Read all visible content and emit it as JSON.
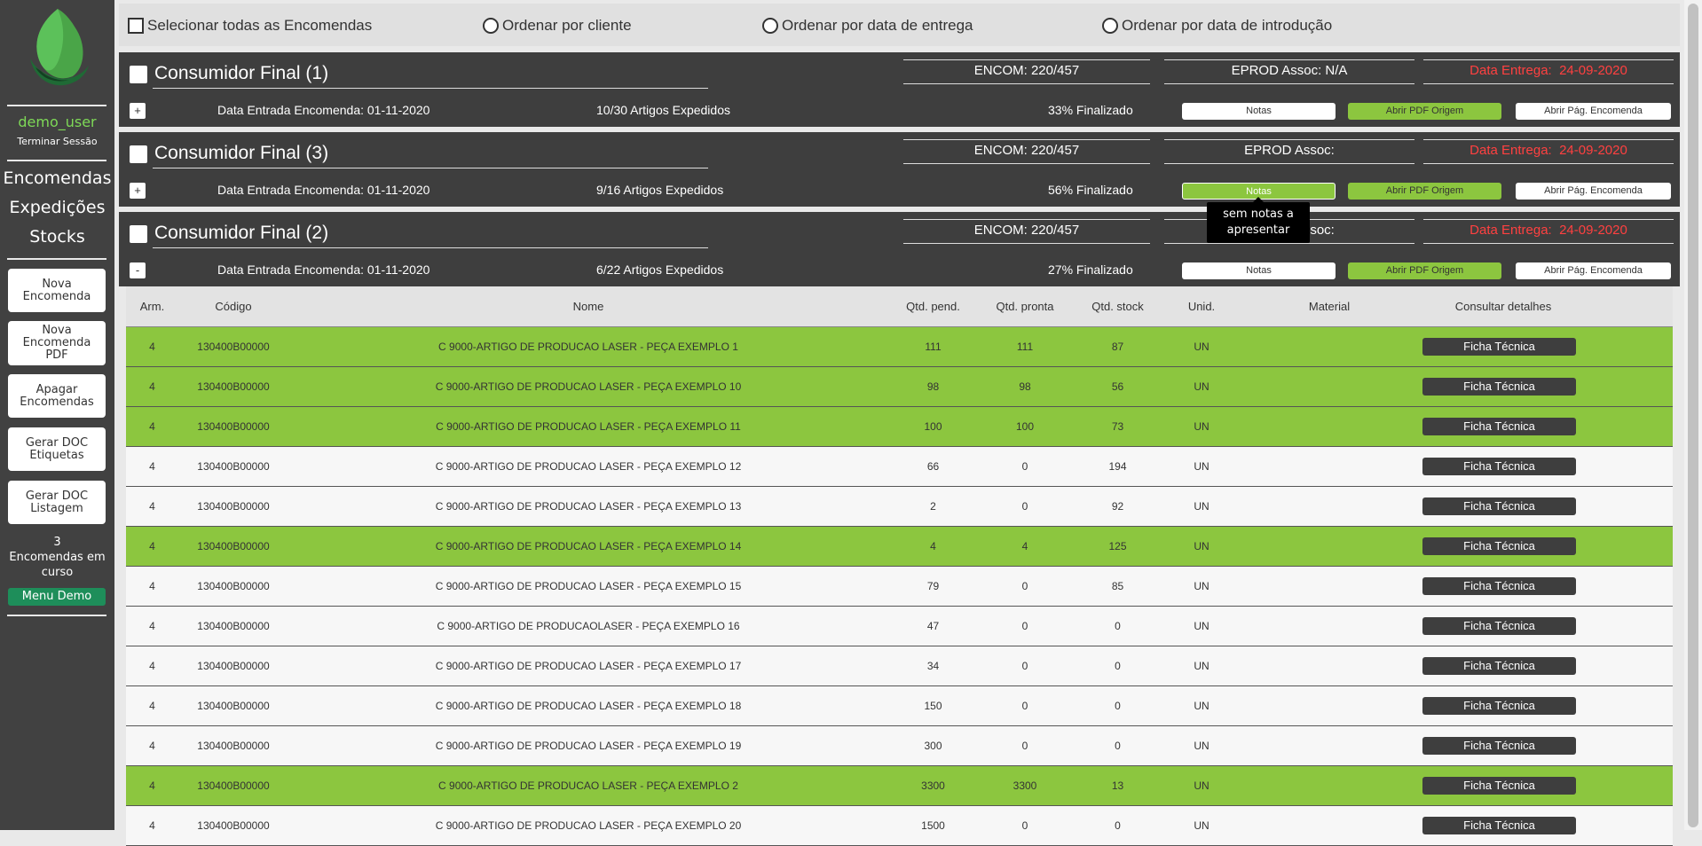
{
  "sidebar": {
    "user": "demo_user",
    "logout": "Terminar Sessão",
    "nav": [
      "Encomendas",
      "Expedições",
      "Stocks"
    ],
    "buttons": [
      "Nova\nEncomenda",
      "Nova\nEncomenda\nPDF",
      "Apagar\nEncomendas",
      "Gerar DOC\nEtiquetas",
      "Gerar DOC\nListagem"
    ],
    "orders_count": "3",
    "orders_label_1": "Encomendas em",
    "orders_label_2": "curso",
    "menu_demo": "Menu Demo"
  },
  "topbar": {
    "select_all": "Selecionar todas as Encomendas",
    "sort_client": "Ordenar por cliente",
    "sort_delivery": "Ordenar por data de entrega",
    "sort_intro": "Ordenar por data de introdução"
  },
  "orders": [
    {
      "title": "Consumidor Final (1)",
      "encom": "ENCOM: 220/457",
      "eprod": "EPROD Assoc: N/A",
      "date_label": "Data Entrega:",
      "date": "24-09-2020",
      "toggle": "+",
      "entry": "Data Entrada Encomenda: 01-11-2020",
      "articles": "10/30 Artigos Expedidos",
      "pct": "33% Finalizado"
    },
    {
      "title": "Consumidor Final (3)",
      "encom": "ENCOM: 220/457",
      "eprod": "EPROD Assoc:",
      "date_label": "Data Entrega:",
      "date": "24-09-2020",
      "toggle": "+",
      "entry": "Data Entrada Encomenda: 01-11-2020",
      "articles": "9/16 Artigos Expedidos",
      "pct": "56% Finalizado"
    },
    {
      "title": "Consumidor Final (2)",
      "encom": "ENCOM: 220/457",
      "eprod": "EPROD Assoc:",
      "date_label": "Data Entrega:",
      "date": "24-09-2020",
      "toggle": "-",
      "entry": "Data Entrada Encomenda: 01-11-2020",
      "articles": "6/22 Artigos Expedidos",
      "pct": "27% Finalizado"
    }
  ],
  "order_buttons": {
    "notas": "Notas",
    "pdf": "Abrir PDF Origem",
    "page": "Abrir Pág. Encomenda"
  },
  "tooltip": {
    "line1": "sem notas a",
    "line2": "apresentar"
  },
  "table": {
    "headers": [
      "Arm.",
      "Código",
      "Nome",
      "Qtd. pend.",
      "Qtd. pronta",
      "Qtd. stock",
      "Unid.",
      "Material",
      "Consultar detalhes"
    ],
    "action_label": "Ficha Técnica",
    "rows": [
      {
        "arm": "4",
        "code": "130400B00000",
        "name": "C 9000-ARTIGO DE PRODUCAO LASER - PEÇA EXEMPLO 1",
        "pend": "111",
        "ready": "111",
        "stock": "87",
        "unit": "UN",
        "material": "",
        "status": "complete"
      },
      {
        "arm": "4",
        "code": "130400B00000",
        "name": "C 9000-ARTIGO DE PRODUCAO LASER - PEÇA EXEMPLO 10",
        "pend": "98",
        "ready": "98",
        "stock": "56",
        "unit": "UN",
        "material": "",
        "status": "complete"
      },
      {
        "arm": "4",
        "code": "130400B00000",
        "name": "C 9000-ARTIGO DE PRODUCAO LASER - PEÇA EXEMPLO 11",
        "pend": "100",
        "ready": "100",
        "stock": "73",
        "unit": "UN",
        "material": "",
        "status": "complete"
      },
      {
        "arm": "4",
        "code": "130400B00000",
        "name": "C 9000-ARTIGO DE PRODUCAO LASER - PEÇA EXEMPLO 12",
        "pend": "66",
        "ready": "0",
        "stock": "194",
        "unit": "UN",
        "material": "",
        "status": "pending"
      },
      {
        "arm": "4",
        "code": "130400B00000",
        "name": "C 9000-ARTIGO DE PRODUCAO LASER - PEÇA EXEMPLO 13",
        "pend": "2",
        "ready": "0",
        "stock": "92",
        "unit": "UN",
        "material": "",
        "status": "pending"
      },
      {
        "arm": "4",
        "code": "130400B00000",
        "name": "C 9000-ARTIGO DE PRODUCAO LASER - PEÇA EXEMPLO 14",
        "pend": "4",
        "ready": "4",
        "stock": "125",
        "unit": "UN",
        "material": "",
        "status": "complete"
      },
      {
        "arm": "4",
        "code": "130400B00000",
        "name": "C 9000-ARTIGO DE PRODUCAO LASER - PEÇA EXEMPLO 15",
        "pend": "79",
        "ready": "0",
        "stock": "85",
        "unit": "UN",
        "material": "",
        "status": "pending"
      },
      {
        "arm": "4",
        "code": "130400B00000",
        "name": "C 9000-ARTIGO DE PRODUCAOLASER - PEÇA EXEMPLO 16",
        "pend": "47",
        "ready": "0",
        "stock": "0",
        "unit": "UN",
        "material": "",
        "status": "pending"
      },
      {
        "arm": "4",
        "code": "130400B00000",
        "name": "C 9000-ARTIGO DE PRODUCAO LASER - PEÇA EXEMPLO 17",
        "pend": "34",
        "ready": "0",
        "stock": "0",
        "unit": "UN",
        "material": "",
        "status": "pending"
      },
      {
        "arm": "4",
        "code": "130400B00000",
        "name": "C 9000-ARTIGO DE PRODUCAO LASER - PEÇA EXEMPLO 18",
        "pend": "150",
        "ready": "0",
        "stock": "0",
        "unit": "UN",
        "material": "",
        "status": "pending"
      },
      {
        "arm": "4",
        "code": "130400B00000",
        "name": "C 9000-ARTIGO DE PRODUCAO LASER - PEÇA EXEMPLO 19",
        "pend": "300",
        "ready": "0",
        "stock": "0",
        "unit": "UN",
        "material": "",
        "status": "pending"
      },
      {
        "arm": "4",
        "code": "130400B00000",
        "name": "C 9000-ARTIGO DE PRODUCAO LASER - PEÇA EXEMPLO 2",
        "pend": "3300",
        "ready": "3300",
        "stock": "13",
        "unit": "UN",
        "material": "",
        "status": "complete"
      },
      {
        "arm": "4",
        "code": "130400B00000",
        "name": "C 9000-ARTIGO DE PRODUCAO LASER - PEÇA EXEMPLO 20",
        "pend": "1500",
        "ready": "0",
        "stock": "0",
        "unit": "UN",
        "material": "",
        "status": "pending"
      }
    ]
  },
  "colors": {
    "complete_row": "#8cc63f",
    "pending_row": "#f7f7f7",
    "dark": "#3e3e3e",
    "date_red": "#ff4040",
    "user_green": "#7ed957",
    "menu_demo": "#1e8e5a"
  }
}
